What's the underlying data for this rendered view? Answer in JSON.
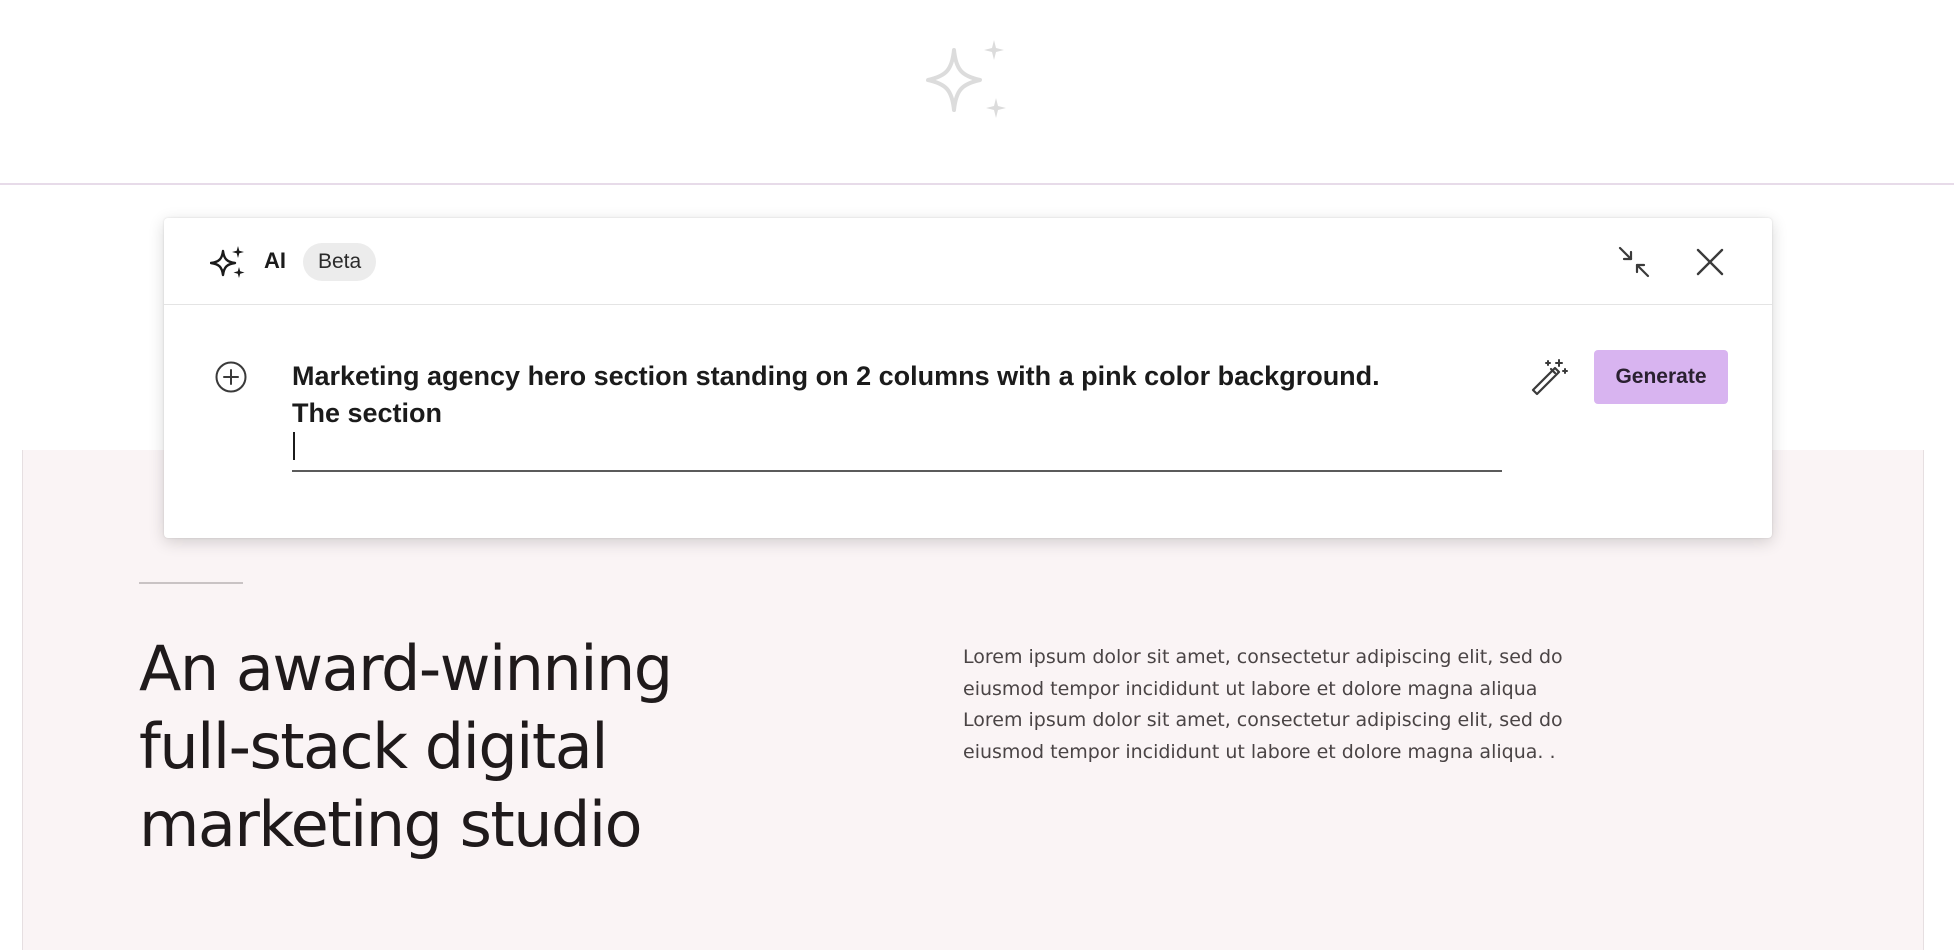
{
  "icons": {
    "top_sparkle": "sparkles-icon",
    "ai": "sparkles-icon",
    "collapse": "collapse-arrows-icon",
    "close": "close-icon",
    "add": "plus-circle-icon",
    "enhance": "magic-wand-icon"
  },
  "colors": {
    "generate_button": "#d8b4f0",
    "hero_background": "#faf4f5",
    "divider": "#e7dbe9"
  },
  "ai_panel": {
    "title": "AI",
    "badge": "Beta",
    "prompt_lines": [
      "Marketing agency hero section standing on 2 columns with a pink color background.",
      "The section"
    ],
    "generate_label": "Generate"
  },
  "hero": {
    "headline_lines": [
      "An award-winning",
      "full-stack digital",
      "marketing studio"
    ],
    "body_lines": [
      "Lorem ipsum dolor sit amet, consectetur adipiscing elit, sed do",
      "eiusmod tempor incididunt ut labore et dolore magna aliqua",
      "Lorem ipsum dolor sit amet, consectetur adipiscing elit, sed do",
      "eiusmod tempor incididunt ut labore et dolore magna aliqua. ."
    ]
  }
}
